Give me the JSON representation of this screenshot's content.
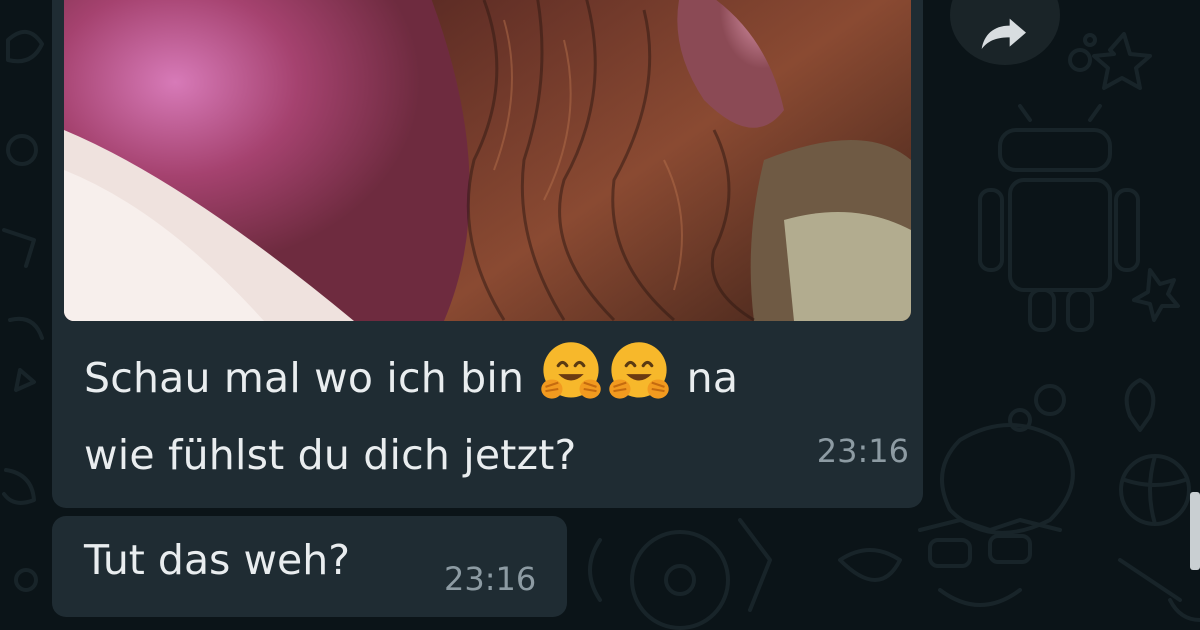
{
  "messages": [
    {
      "type": "image",
      "caption_line1_a": "Schau mal wo ich bin",
      "caption_line1_b": "na",
      "caption_line2": "wie fühlst du dich jetzt?",
      "emojis": [
        "hugging-face-emoji",
        "hugging-face-emoji"
      ],
      "time": "23:16"
    },
    {
      "type": "text",
      "text": "Tut das weh?",
      "time": "23:16"
    }
  ],
  "icons": {
    "forward": "forward-arrow-icon"
  },
  "colors": {
    "bubble": "#1f2c33",
    "background": "#0b1418",
    "text": "#e9edef",
    "timestamp": "#8d9ba3"
  }
}
